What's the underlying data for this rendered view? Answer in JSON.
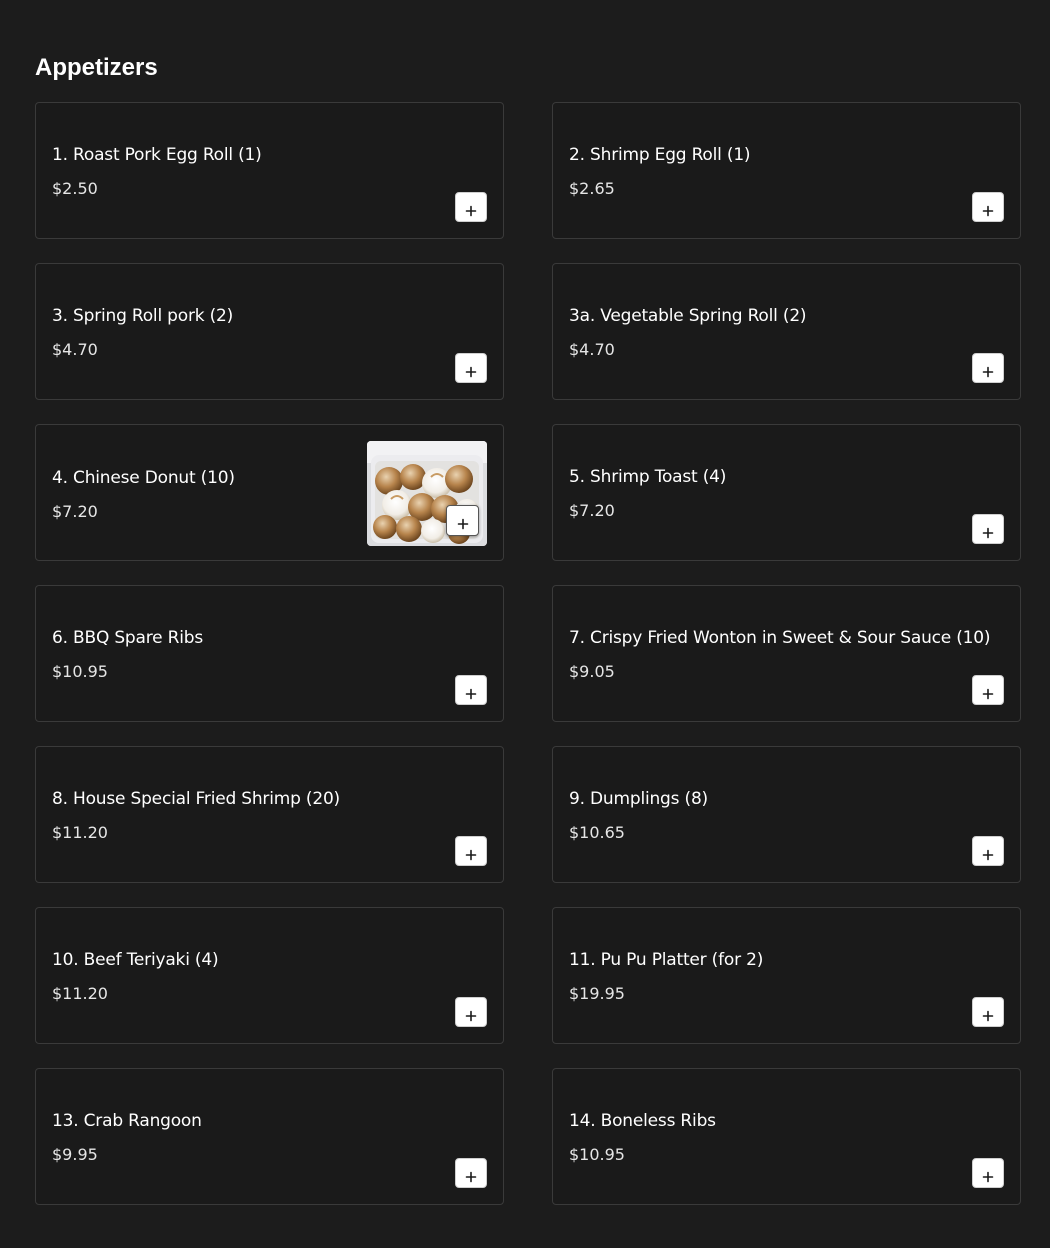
{
  "section": {
    "title": "Appetizers"
  },
  "add_button_icon": "plus-icon",
  "items": [
    {
      "name": "1. Roast Pork Egg Roll (1)",
      "price": "$2.50"
    },
    {
      "name": "2. Shrimp Egg Roll (1)",
      "price": "$2.65"
    },
    {
      "name": "3. Spring Roll pork (2)",
      "price": "$4.70"
    },
    {
      "name": "3a. Vegetable Spring Roll (2)",
      "price": "$4.70"
    },
    {
      "name": "4. Chinese Donut (10)",
      "price": "$7.20",
      "photo": "chinese-donut-photo"
    },
    {
      "name": "5. Shrimp Toast (4)",
      "price": "$7.20"
    },
    {
      "name": "6. BBQ Spare Ribs",
      "price": "$10.95"
    },
    {
      "name": "7. Crispy Fried Wonton in Sweet & Sour Sauce (10)",
      "price": "$9.05"
    },
    {
      "name": "8. House Special Fried Shrimp (20)",
      "price": "$11.20"
    },
    {
      "name": "9. Dumplings (8)",
      "price": "$10.65"
    },
    {
      "name": "10. Beef Teriyaki (4)",
      "price": "$11.20"
    },
    {
      "name": "11. Pu Pu Platter (for 2)",
      "price": "$19.95"
    },
    {
      "name": "13. Crab Rangoon",
      "price": "$9.95"
    },
    {
      "name": "14. Boneless Ribs",
      "price": "$10.95"
    }
  ]
}
